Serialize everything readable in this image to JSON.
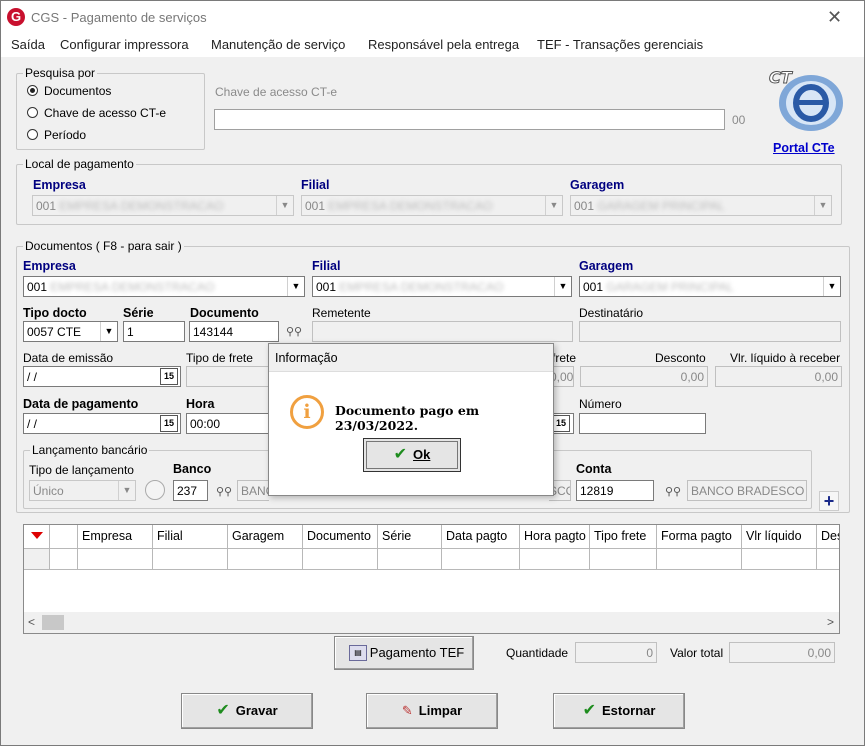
{
  "window": {
    "title": "CGS - Pagamento de serviços",
    "app_logo": "G",
    "close_icon": "✕"
  },
  "menu": [
    "Saída",
    "Configurar impressora",
    "Manutenção de serviço",
    "Responsável pela entrega",
    "TEF - Transações gerenciais"
  ],
  "pesquisa": {
    "legend": "Pesquisa por",
    "options": [
      "Documentos",
      "Chave de acesso CT-e",
      "Período"
    ],
    "selected": "Documentos",
    "chave_label": "Chave de acesso CT-e",
    "chave_value": "",
    "chave_suffix": "00",
    "portal_label": "Portal CTe"
  },
  "local_pagamento": {
    "legend": "Local de pagamento",
    "empresa_label": "Empresa",
    "empresa_value": "001",
    "filial_label": "Filial",
    "filial_value": "001",
    "garagem_label": "Garagem",
    "garagem_value": "001"
  },
  "documentos": {
    "legend": "Documentos ( F8 - para sair )",
    "empresa_label": "Empresa",
    "empresa_value": "001",
    "filial_label": "Filial",
    "filial_value": "001",
    "garagem_label": "Garagem",
    "garagem_value": "001",
    "tipo_docto_label": "Tipo docto",
    "tipo_docto_value": "0057 CTE",
    "serie_label": "Série",
    "serie_value": "1",
    "documento_label": "Documento",
    "documento_value": "143144",
    "remetente_label": "Remetente",
    "destinatario_label": "Destinatário",
    "data_emissao_label": "Data de emissão",
    "data_emissao_value": "/ /",
    "tipo_frete_label": "Tipo de frete",
    "frete_label": "frete",
    "frete_value": "0,00",
    "desconto_label": "Desconto",
    "desconto_value": "0,00",
    "vlr_liquido_label": "Vlr. líquido à receber",
    "vlr_liquido_value": "0,00",
    "data_pagamento_label": "Data de pagamento",
    "data_pagamento_value": "/ /",
    "hora_label": "Hora",
    "hora_value": "00:00",
    "numero_label": "Número",
    "numero_value": "",
    "calendar_icon_text": "15"
  },
  "lancamento": {
    "legend": "Lançamento bancário",
    "tipo_label": "Tipo de lançamento",
    "tipo_value": "Único",
    "banco_label": "Banco",
    "banco_value": "237",
    "banco_name_partial": "BANC",
    "banco_name_partial2": "SCO",
    "conta_label": "Conta",
    "conta_value": "12819",
    "conta_banco": "BANCO BRADESCO",
    "add_icon": "+"
  },
  "grid": {
    "columns": [
      "Empresa",
      "Filial",
      "Garagem",
      "Documento",
      "Série",
      "Data pagto",
      "Hora pagto",
      "Tipo frete",
      "Forma pagto",
      "Vlr líquido",
      "Des"
    ]
  },
  "footer": {
    "pagamento_tef_label": "Pagamento TEF",
    "quantidade_label": "Quantidade",
    "quantidade_value": "0",
    "valor_total_label": "Valor total",
    "valor_total_value": "0,00",
    "gravar_label": "Gravar",
    "limpar_label": "Limpar",
    "estornar_label": "Estornar"
  },
  "dialog": {
    "title": "Informação",
    "message": "Documento pago em 23/03/2022.",
    "ok_label": "Ok",
    "icon": "i"
  }
}
